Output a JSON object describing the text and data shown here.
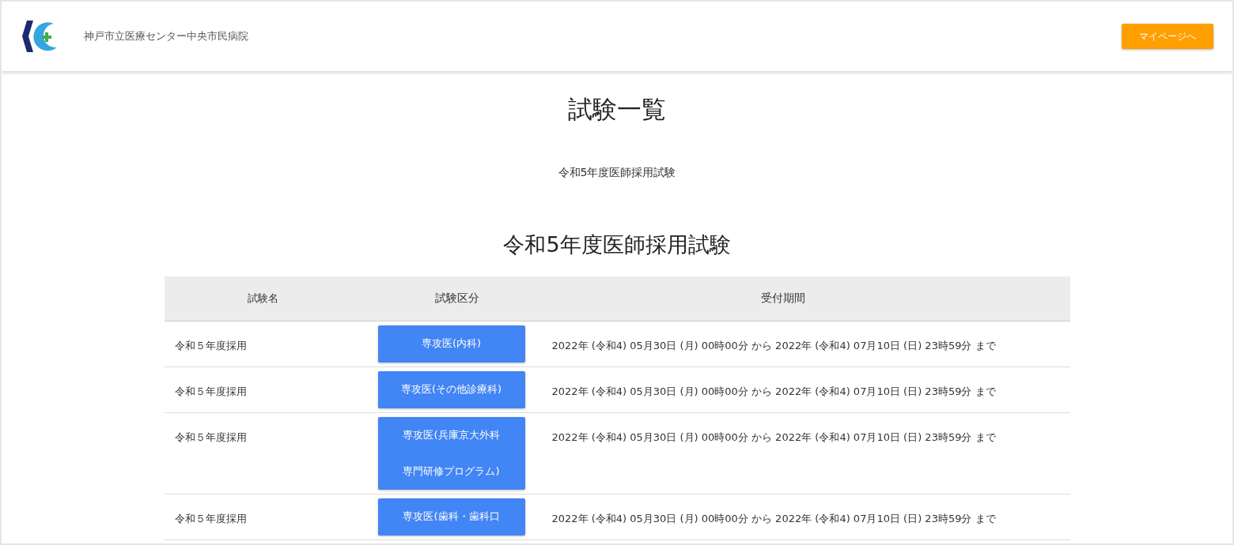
{
  "header": {
    "hospital_name": "神戸市立医療センター中央市民病院",
    "mypage_button": "マイページへ"
  },
  "page_title": "試験一覧",
  "exam_links": [
    "令和5年度医師採用試験"
  ],
  "section": {
    "heading": "令和5年度医師採用試験",
    "table": {
      "columns": [
        "試験名",
        "試験区分",
        "受付期間"
      ],
      "rows": [
        {
          "name": "令和５年度採用",
          "category_lines": [
            "専攻医(内科)"
          ],
          "period": "2022年 (令和4) 05月30日 (月) 00時00分 から 2022年 (令和4) 07月10日 (日) 23時59分 まで"
        },
        {
          "name": "令和５年度採用",
          "category_lines": [
            "専攻医(その他診療科)"
          ],
          "period": "2022年 (令和4) 05月30日 (月) 00時00分 から 2022年 (令和4) 07月10日 (日) 23時59分 まで"
        },
        {
          "name": "令和５年度採用",
          "category_lines": [
            "専攻医(兵庫京大外科",
            "専門研修プログラム)"
          ],
          "period": "2022年 (令和4) 05月30日 (月) 00時00分 から 2022年 (令和4) 07月10日 (日) 23時59分 まで"
        },
        {
          "name": "令和５年度採用",
          "category_lines": [
            "専攻医(歯科・歯科口"
          ],
          "period": "2022年 (令和4) 05月30日 (月) 00時00分 から 2022年 (令和4) 07月10日 (日) 23時59分 まで"
        }
      ]
    }
  }
}
